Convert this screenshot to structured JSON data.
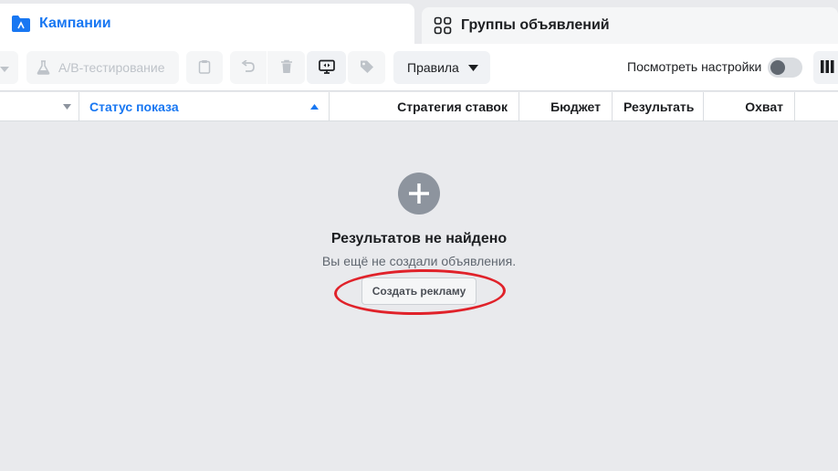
{
  "tabs": {
    "campaigns": "Кампании",
    "adsets": "Группы объявлений"
  },
  "toolbar": {
    "ab_test_label": "A/B-тестирование",
    "rules_label": "Правила",
    "view_settings_label": "Посмотреть настройки",
    "view_settings_on": false
  },
  "table": {
    "columns": [
      "Статус показа",
      "Стратегия ставок",
      "Бюджет",
      "Результать",
      "Охват"
    ],
    "sorted_column": "Статус показа"
  },
  "empty_state": {
    "title": "Результатов не найдено",
    "subtitle": "Вы ещё не создали объявления.",
    "create_button": "Создать рекламу"
  },
  "colors": {
    "accent": "#1877f2",
    "annotation": "#e0222a",
    "background": "#e9eaed"
  },
  "icons": [
    "folder-icon",
    "grid-icon",
    "dropdown-icon",
    "flask-icon",
    "clipboard-icon",
    "undo-icon",
    "trash-icon",
    "preview-icon",
    "tag-icon",
    "caret-down-icon",
    "columns-icon",
    "sort-asc-icon",
    "plus-icon"
  ]
}
